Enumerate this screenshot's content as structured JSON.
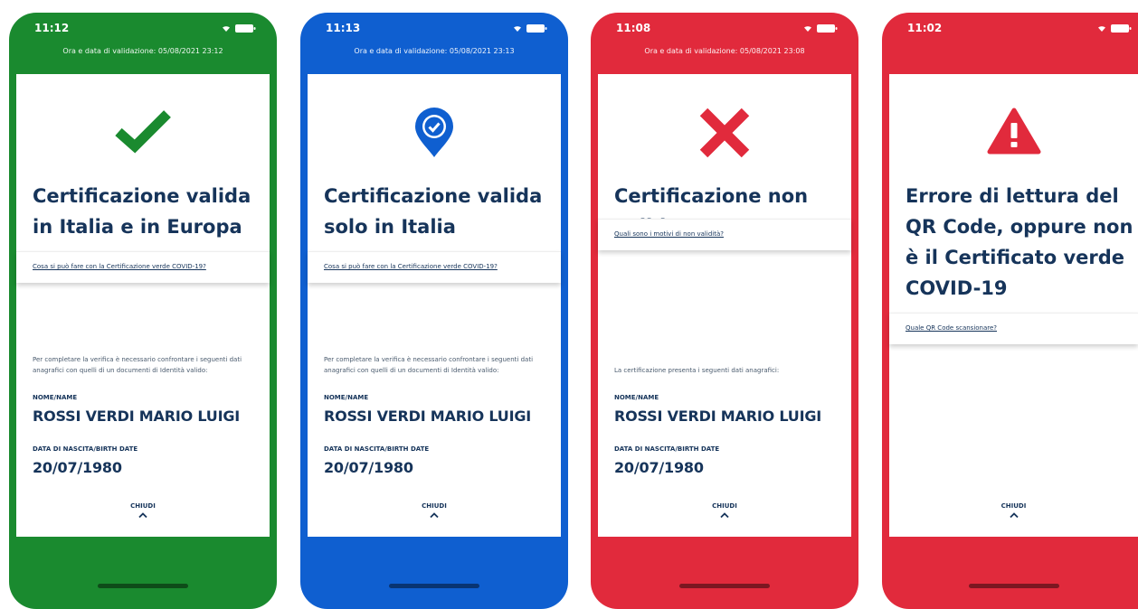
{
  "colors": {
    "green": "#1a8a2f",
    "blue": "#0f5fd0",
    "red": "#e12a3c",
    "title_text": "#16345a",
    "icon_green": "#1a8a2f",
    "icon_blue": "#0f5fd0",
    "icon_red": "#e12a3c"
  },
  "screens": [
    {
      "time": "11:12",
      "validation": "Ora e data di validazione: 05/08/2021 23:12",
      "icon": "check-icon",
      "title": "Certificazione valida in Italia e in Europa",
      "link": "Cosa si può fare con la Certificazione verde COVID-19?",
      "note": "Per completare la verifica è necessario confrontare i seguenti dati anagrafici con quelli di un documenti di Identità valido:",
      "name_label": "NOME/NAME",
      "name_value": "ROSSI VERDI MARIO LUIGI",
      "birth_label": "DATA DI NASCITA/BIRTH DATE",
      "birth_value": "20/07/1980",
      "close_label": "CHIUDI"
    },
    {
      "time": "11:13",
      "validation": "Ora e data di validazione: 05/08/2021 23:13",
      "icon": "location-check-icon",
      "title": "Certificazione valida solo in Italia",
      "link": "Cosa si può fare con la Certificazione verde COVID-19?",
      "note": "Per completare la verifica è necessario confrontare i seguenti dati anagrafici con quelli di un documenti di Identità valido:",
      "name_label": "NOME/NAME",
      "name_value": "ROSSI VERDI MARIO LUIGI",
      "birth_label": "DATA DI NASCITA/BIRTH DATE",
      "birth_value": "20/07/1980",
      "close_label": "CHIUDI"
    },
    {
      "time": "11:08",
      "validation": "Ora e data di validazione: 05/08/2021 23:08",
      "icon": "cross-icon",
      "title": "Certificazione non valida",
      "link": "Quali sono i motivi di non validità?",
      "note": "La certificazione presenta i seguenti dati anagrafici:",
      "name_label": "NOME/NAME",
      "name_value": "ROSSI VERDI MARIO LUIGI",
      "birth_label": "DATA DI NASCITA/BIRTH DATE",
      "birth_value": "20/07/1980",
      "close_label": "CHIUDI"
    },
    {
      "time": "11:02",
      "validation": "",
      "icon": "warning-icon",
      "title": "Errore di lettura del QR Code, oppure non è il Certificato verde COVID-19",
      "link": "Quale QR Code scansionare?",
      "close_label": "CHIUDI"
    }
  ]
}
